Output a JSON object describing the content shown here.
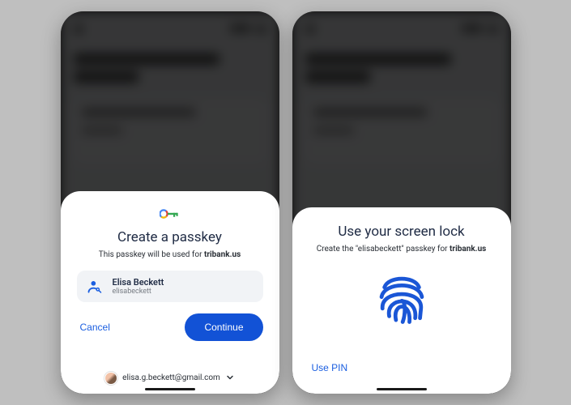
{
  "phone1": {
    "sheet": {
      "title": "Create a passkey",
      "subtitle_prefix": "This passkey will be used for ",
      "domain": "tribank.us",
      "account": {
        "name": "Elisa Beckett",
        "username": "elisabeckett"
      },
      "cancel_label": "Cancel",
      "continue_label": "Continue",
      "google_account_email": "elisa.g.beckett@gmail.com"
    }
  },
  "phone2": {
    "sheet": {
      "title": "Use your screen lock",
      "subtitle_prefix": "Create the ",
      "subtitle_passkey_name": "\"elisabeckett\"",
      "subtitle_mid": " passkey for ",
      "domain": "tribank.us",
      "use_pin_label": "Use PIN"
    }
  },
  "colors": {
    "primary_blue": "#1252d6",
    "link_blue": "#1a5ee0",
    "fingerprint_blue": "#1a56d6"
  }
}
